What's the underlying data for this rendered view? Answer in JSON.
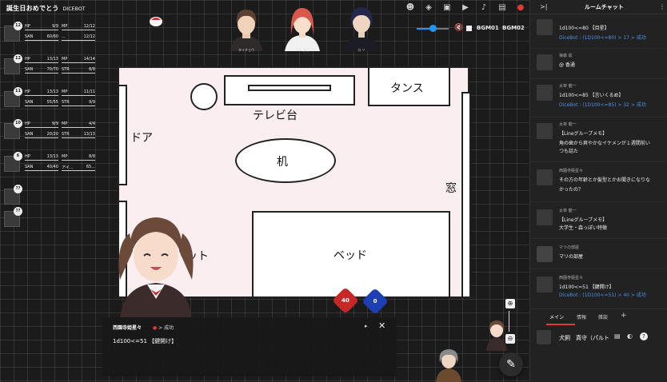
{
  "room": {
    "title": "誕生日おめでとう",
    "subtitle": "DICEBOT"
  },
  "stands": [
    {
      "name": "タイチョウ"
    },
    {
      "name": "TVE 真守"
    },
    {
      "name": "ロ ソ"
    }
  ],
  "toolbar": {
    "icons": [
      "avatar-icon",
      "layers-icon",
      "image-icon",
      "video-icon",
      "music-icon",
      "settings-icon",
      "cake-icon"
    ],
    "bgm1_label": "BGM01",
    "bgm2_label": "BGM02",
    "volume_level": 0.5
  },
  "characters": [
    {
      "badge": "12",
      "stats": [
        [
          "HP",
          "9/9"
        ],
        [
          "MP",
          "12/12"
        ],
        [
          "SAN",
          "60/60"
        ],
        [
          "...",
          "12/12"
        ]
      ]
    },
    {
      "badge": "12",
      "stats": [
        [
          "HP",
          "13/13"
        ],
        [
          "MP",
          "14/14"
        ],
        [
          "SAN",
          "70/70"
        ],
        [
          "STR",
          "8/8"
        ]
      ]
    },
    {
      "badge": "11",
      "stats": [
        [
          "HP",
          "13/13"
        ],
        [
          "MP",
          "11/11"
        ],
        [
          "SAN",
          "55/55"
        ],
        [
          "STR",
          "9/9"
        ]
      ]
    },
    {
      "badge": "10",
      "stats": [
        [
          "HP",
          "9/9"
        ],
        [
          "MP",
          "4/4"
        ],
        [
          "SAN",
          "20/20"
        ],
        [
          "STR",
          "13/13"
        ]
      ]
    },
    {
      "badge": "6",
      "stats": [
        [
          "HP",
          "13/13"
        ],
        [
          "MP",
          "8/8"
        ],
        [
          "SAN",
          "40/40"
        ],
        [
          "アイ...",
          "65..."
        ]
      ]
    },
    {
      "badge": "??",
      "stats": []
    },
    {
      "badge": "??",
      "stats": []
    }
  ],
  "map": {
    "labels": {
      "tv_stand": "テレビ台",
      "chest": "タンス",
      "door": "ドア",
      "desk": "机",
      "window": "窓",
      "bed": "ベッド",
      "closet": "ット"
    }
  },
  "dice": [
    {
      "value": "40",
      "color": "#c62828"
    },
    {
      "value": "0",
      "color": "#1e3fb3"
    }
  ],
  "popup": {
    "speaker": "西園寺姫星々",
    "result": "> 成功",
    "message": "1d100<=51 【鍵開け】"
  },
  "panel": {
    "collapse": ">|",
    "title": "ルームチャット",
    "menu": "⋮",
    "messages": [
      {
        "who": "",
        "lines": [
          [
            "1d100<=80 【目星】",
            false
          ],
          [
            "DiceBot : (1D100<=80) > 17 > 成功",
            true
          ]
        ]
      },
      {
        "who": "狼森 紘",
        "lines": [
          [
            "@ 香通",
            false
          ]
        ]
      },
      {
        "who": "太宰 龍一",
        "lines": [
          [
            "1d100<=85 【言いくるめ】",
            false
          ],
          [
            "DiceBot : (1D100<=85) > 32 > 成功",
            true
          ]
        ]
      },
      {
        "who": "太宰 龍一",
        "lines": [
          [
            "【Lineグループメモ】",
            false
          ],
          [
            "角の歯から爽やかなイケメンが１週間前い",
            false
          ],
          [
            "つも話た",
            false
          ]
        ]
      },
      {
        "who": "西園寺姫星々",
        "lines": [
          [
            "その方の年齢とか髪型とかお聞きになりな",
            false
          ],
          [
            "かったの？",
            false
          ]
        ]
      },
      {
        "who": "太宰 龍一",
        "lines": [
          [
            "【Lineグループメモ】",
            false
          ],
          [
            "大学生・森っぽい特徴",
            false
          ]
        ]
      },
      {
        "who": "マリの部屋",
        "lines": [
          [
            "マリの部屋",
            false
          ]
        ]
      },
      {
        "who": "西園寺姫星々",
        "lines": [
          [
            "1d100<=51 【鍵開け】",
            false
          ],
          [
            "DiceBot : (1D100<=51) > 40 > 成功",
            true
          ]
        ]
      }
    ],
    "tabs": [
      "メイン",
      "情報",
      "雑談",
      "+"
    ],
    "composer": {
      "name": "犬飼　真守（パルト",
      "icons": [
        "list-icon",
        "palette-icon",
        "help-icon"
      ]
    }
  }
}
